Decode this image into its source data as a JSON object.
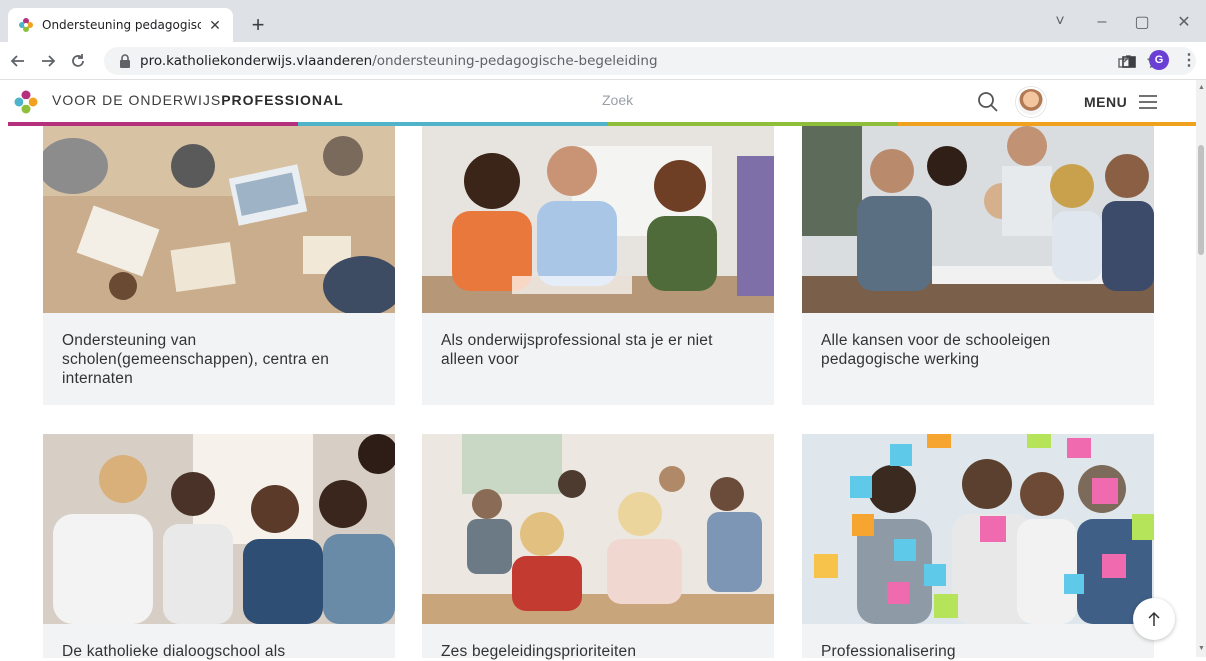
{
  "browser": {
    "tab_title": "Ondersteuning pedagogische begel",
    "tab_close": "✕",
    "new_tab": "+",
    "url_domain": "pro.katholiekonderwijs.vlaanderen",
    "url_path": "/ondersteuning-pedagogische-begeleiding",
    "profile_initial": "G",
    "window_controls": [
      "˅",
      "–",
      "▢",
      "✕"
    ]
  },
  "site": {
    "title_regular": "VOOR DE ONDERWIJS",
    "title_bold": "PROFESSIONAL",
    "search_placeholder": "Zoek",
    "menu_label": "MENU",
    "accent_colors": [
      "#b5307c",
      "#4fb3c9",
      "#8fbf3a",
      "#f0a21f"
    ]
  },
  "cards": [
    {
      "title": "Ondersteuning van scholen(gemeenschappen), centra en internaten",
      "image": "office-desk-photo"
    },
    {
      "title": "Als onderwijsprofessional sta je er niet alleen voor",
      "image": "team-laughing-photo"
    },
    {
      "title": "Alle kansen voor de schooleigen pedagogische werking",
      "image": "meeting-table-photo"
    },
    {
      "title": "De katholieke dialoogschool als",
      "image": "group-cheering-photo"
    },
    {
      "title": "Zes begeleidingsprioriteiten",
      "image": "classroom-photo"
    },
    {
      "title": "Professionalisering",
      "image": "sticky-notes-photo"
    }
  ]
}
